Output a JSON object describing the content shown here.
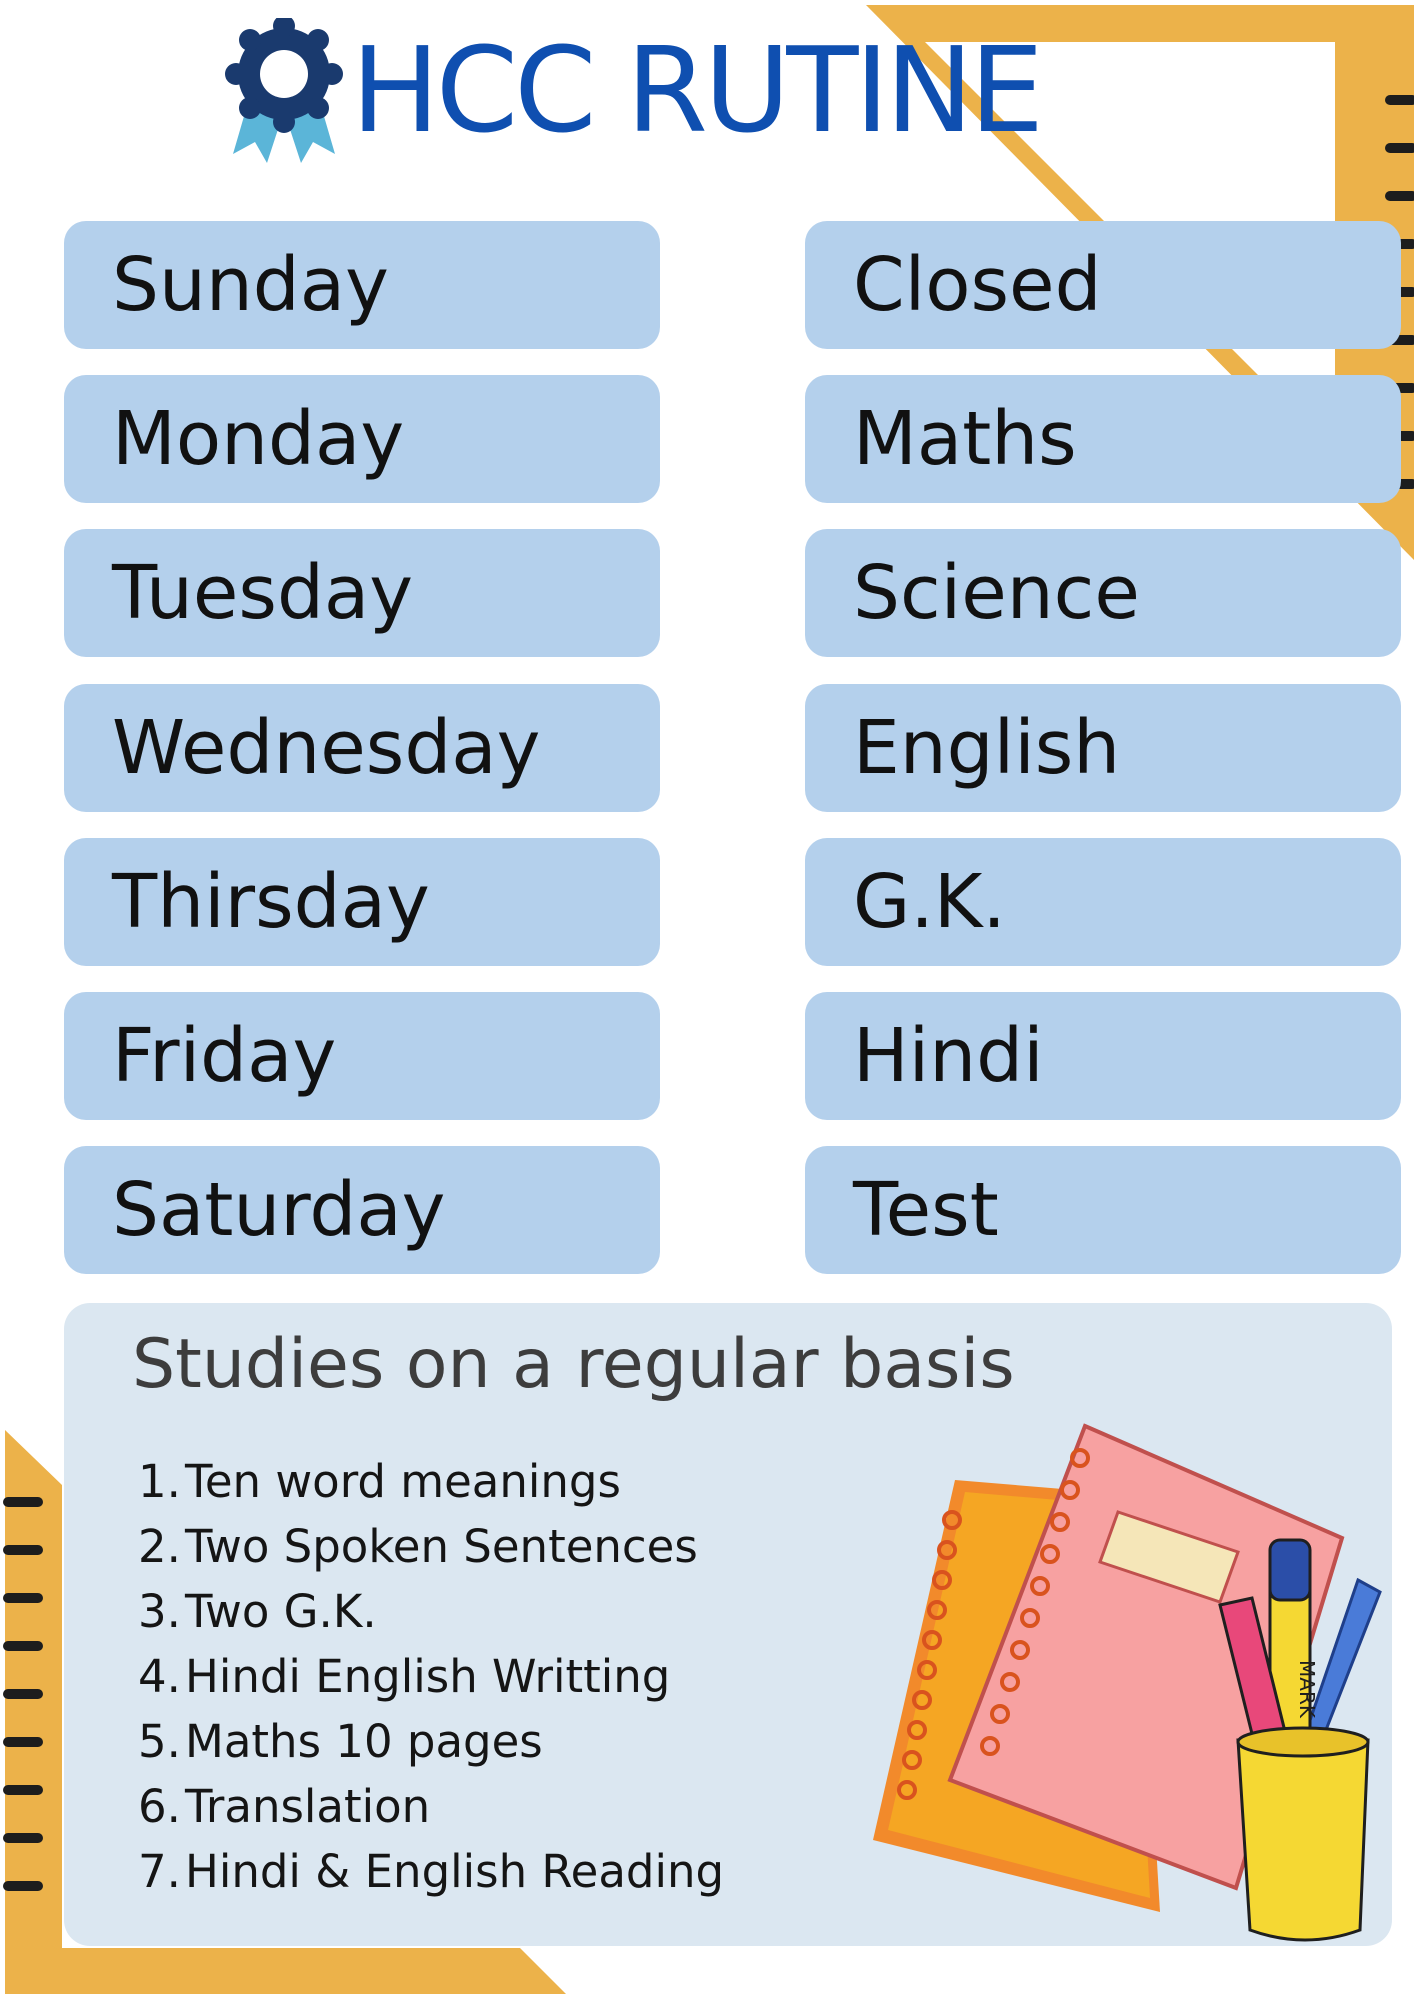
{
  "header": {
    "title": "HCC RUTINE",
    "icon": "badge-ribbon-icon"
  },
  "schedule": [
    {
      "day": "Sunday",
      "subject": "Closed"
    },
    {
      "day": "Monday",
      "subject": "Maths"
    },
    {
      "day": "Tuesday",
      "subject": "Science"
    },
    {
      "day": "Wednesday",
      "subject": "English"
    },
    {
      "day": "Thirsday",
      "subject": "G.K."
    },
    {
      "day": "Friday",
      "subject": "Hindi"
    },
    {
      "day": "Saturday",
      "subject": "Test"
    }
  ],
  "studies": {
    "title": "Studies on a regular basis",
    "items": [
      {
        "num": "1.",
        "text": "Ten word meanings"
      },
      {
        "num": "2.",
        "text": "Two Spoken Sentences"
      },
      {
        "num": "3.",
        "text": "Two G.K."
      },
      {
        "num": "4.",
        "text": "Hindi English Writting"
      },
      {
        "num": "5.",
        "text": "Maths 10 pages"
      },
      {
        "num": "6.",
        "text": "Translation"
      },
      {
        "num": "7.",
        "text": "Hindi & English Reading"
      }
    ]
  },
  "illustration": {
    "marker_text": "MARK",
    "icons": [
      "notebook-icon",
      "pencil-cup-icon"
    ]
  },
  "colors": {
    "title": "#0f4fb0",
    "pill": "#b4d0ec",
    "panel": "#dbe7f1",
    "ruler": "#ecb24a"
  }
}
